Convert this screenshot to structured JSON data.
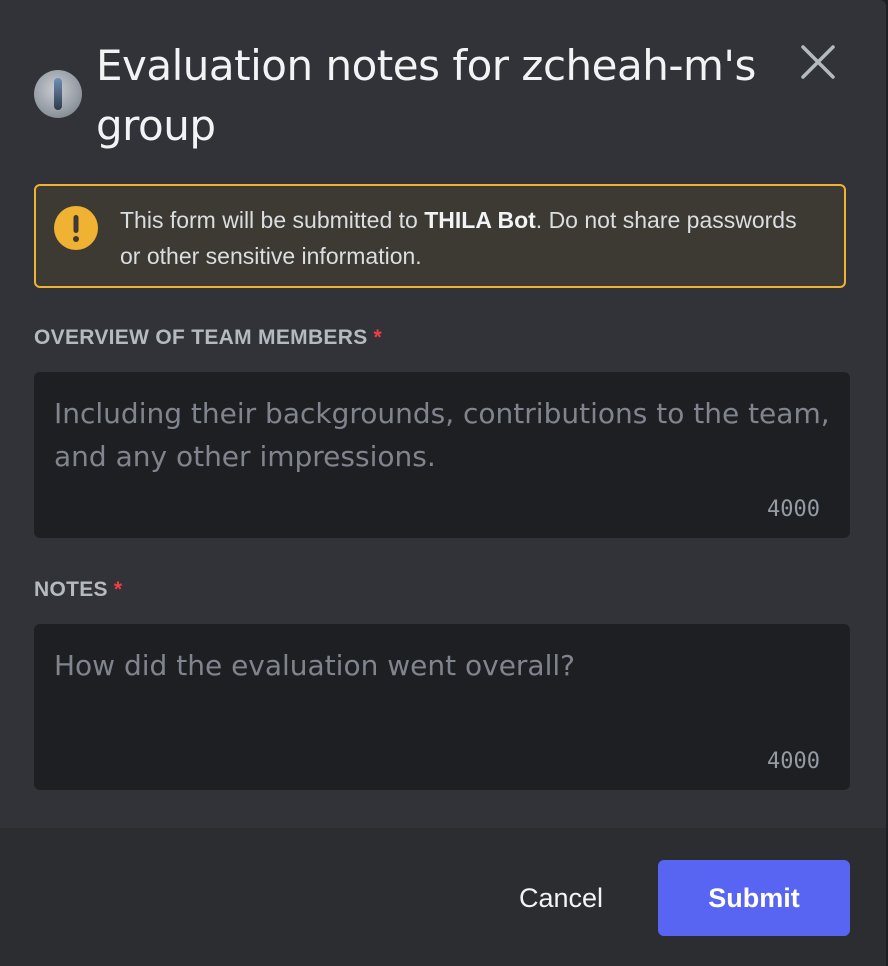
{
  "modal": {
    "title": "Evaluation notes for zcheah-m's group",
    "close_icon": "close-icon",
    "avatar_icon": "bot-avatar"
  },
  "warning": {
    "prefix": "This form will be submitted to ",
    "bot_name": "THILA Bot",
    "suffix": ". Do not share passwords or other sensitive information.",
    "icon": "warning-icon",
    "color": "#f0b232"
  },
  "fields": [
    {
      "label": "OVERVIEW OF TEAM MEMBERS",
      "required_mark": "*",
      "placeholder": "Including their backgrounds, contributions to the team, and any other impressions.",
      "counter": "4000"
    },
    {
      "label": "NOTES",
      "required_mark": "*",
      "placeholder": "How did the evaluation went overall?",
      "counter": "4000"
    }
  ],
  "footer": {
    "cancel_label": "Cancel",
    "submit_label": "Submit",
    "submit_color": "#5865f2"
  }
}
